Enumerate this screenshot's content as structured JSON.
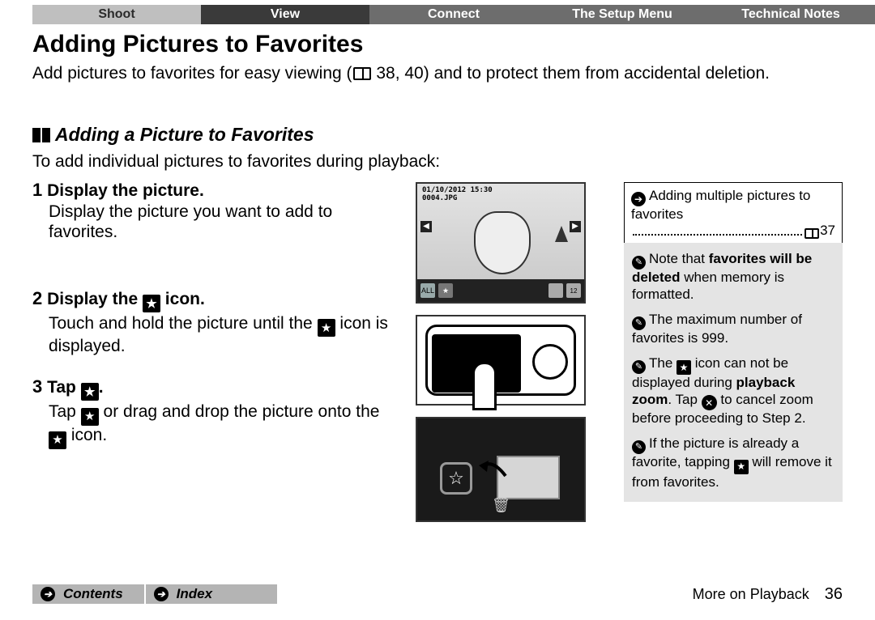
{
  "tabs": {
    "shoot": "Shoot",
    "view": "View",
    "connect": "Connect",
    "setup": "The Setup Menu",
    "tech": "Technical Notes"
  },
  "title": "Adding Pictures to Favorites",
  "intro_a": "Add pictures to favorites for easy viewing (",
  "intro_b": " 38, 40) and to protect them from accidental deletion.",
  "subhead": "Adding a Picture to Favorites",
  "lead": "To add individual pictures to favorites during playback:",
  "steps": {
    "s1_num": "1",
    "s1_title": "Display the picture.",
    "s1_body": "Display the picture you want to add to favorites.",
    "s2_num": "2",
    "s2_title_a": "Display the ",
    "s2_title_b": " icon.",
    "s2_body_a": "Touch and hold the picture until the ",
    "s2_body_b": " icon is displayed.",
    "s3_num": "3",
    "s3_title_a": "Tap ",
    "s3_title_b": ".",
    "s3_body_a": "Tap ",
    "s3_body_b": " or drag and drop the picture onto the ",
    "s3_body_c": " icon."
  },
  "ill1": {
    "date": "01/10/2012 15:30",
    "file": "0004.JPG",
    "all": "ALL",
    "count": "12"
  },
  "linkbox": {
    "text": "Adding multiple pictures to favorites",
    "page": " 37"
  },
  "notes": {
    "n1_a": "Note that ",
    "n1_b": "favorites will be deleted",
    "n1_c": " when memory is formatted.",
    "n2": "The maximum number of favorites is 999.",
    "n3_a": "The ",
    "n3_b": " icon can not be displayed during ",
    "n3_c": "playback zoom",
    "n3_d": ". Tap ",
    "n3_e": " to cancel zoom before proceeding to Step 2.",
    "n4_a": "If the picture is already a favorite, tapping ",
    "n4_b": " will remove it from favorites."
  },
  "footer": {
    "contents": "Contents",
    "index": "Index",
    "section": "More on Playback",
    "page": "36"
  }
}
